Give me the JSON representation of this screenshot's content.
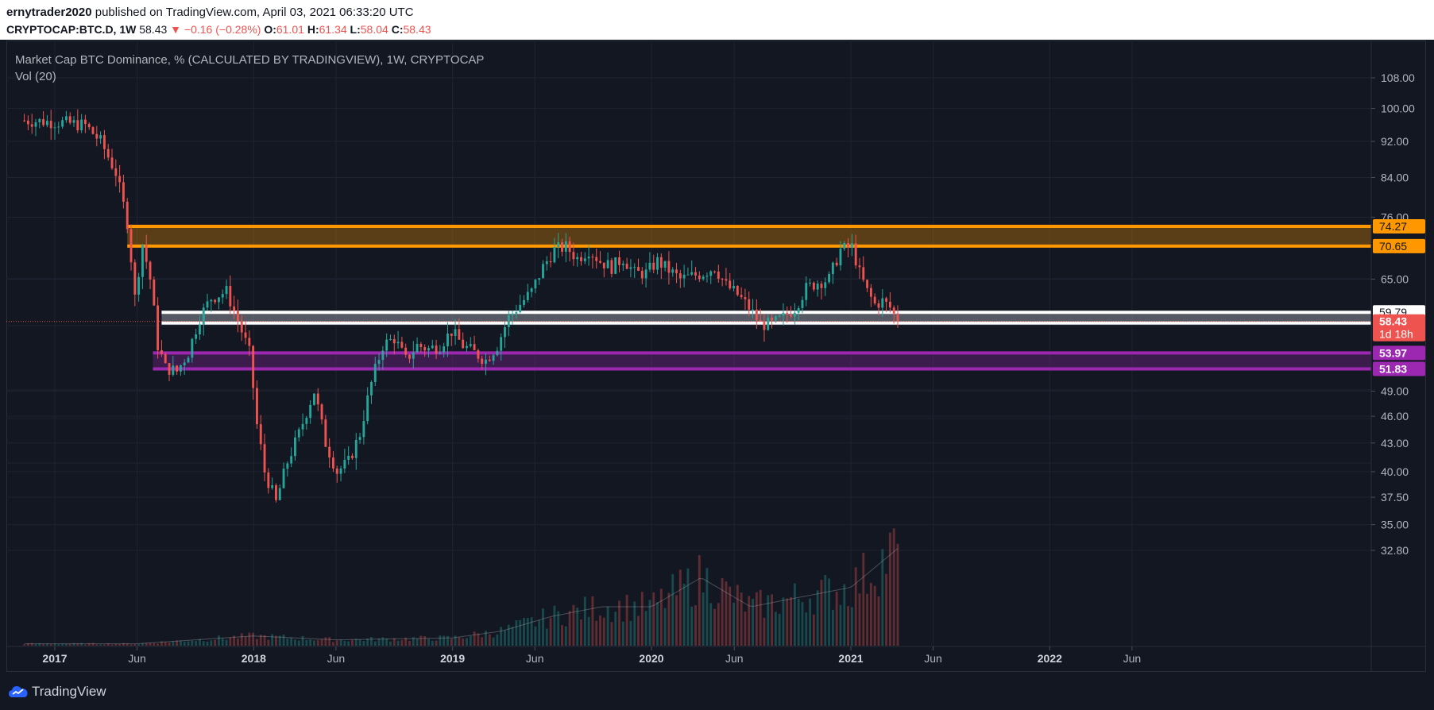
{
  "header": {
    "author": "ernytrader2020",
    "published_text": " published on TradingView.com, April 03, 2021 06:33:20 UTC",
    "symbol": "CRYPTOCAP:BTC.D, 1W",
    "last_price": "58.43",
    "change": "−0.16 (−0.28%)",
    "open_label": "O:",
    "open_value": "61.01",
    "high_label": "H:",
    "high_value": "61.34",
    "low_label": "L:",
    "low_value": "58.04",
    "close_label": "C:",
    "close_value": "58.43"
  },
  "legend": {
    "title": "Market Cap BTC Dominance, % (CALCULATED BY TRADINGVIEW), 1W, CRYPTOCAP",
    "volume": "Vol (20)"
  },
  "footer": {
    "brand": "TradingView"
  },
  "colors": {
    "background": "#131722",
    "up": "#26a69a",
    "down": "#ef5350",
    "orange_zone": "#ff9800",
    "purple_zone": "#9c27b0",
    "white_zone": "#ffffff"
  },
  "chart_data": {
    "type": "candlestick",
    "title": "Market Cap BTC Dominance, % (CALCULATED BY TRADINGVIEW), 1W, CRYPTOCAP",
    "x_tick_labels": [
      "2017",
      "Jun",
      "2018",
      "Jun",
      "2019",
      "Jun",
      "2020",
      "Jun",
      "2021",
      "Jun",
      "2022",
      "Jun"
    ],
    "x_tick_dates": [
      "2017-01-01",
      "2017-06-01",
      "2018-01-01",
      "2018-06-01",
      "2019-01-01",
      "2019-06-01",
      "2020-01-01",
      "2020-06-01",
      "2021-01-01",
      "2021-06-01",
      "2022-01-01",
      "2022-06-01"
    ],
    "y_tick_labels": [
      "108.00",
      "100.00",
      "92.00",
      "84.00",
      "76.00",
      "65.00",
      "49.00",
      "46.00",
      "43.00",
      "40.00",
      "37.50",
      "35.00",
      "32.80"
    ],
    "y_axis": "log",
    "ylim": [
      32.0,
      110.0
    ],
    "last_price": 58.43,
    "countdown": "1d 18h",
    "zones": [
      {
        "name": "orange",
        "top": 74.27,
        "bottom": 70.65,
        "top_label": "74.27",
        "bottom_label": "70.65"
      },
      {
        "name": "white",
        "top": 59.79,
        "bottom": 58.19,
        "top_label": "59.79",
        "bottom_label": "58.19"
      },
      {
        "name": "purple",
        "top": 53.97,
        "bottom": 51.83,
        "top_label": "53.97",
        "bottom_label": "51.83"
      }
    ],
    "price_path": {
      "dates": [
        "2016-11-06",
        "2017-01-15",
        "2017-02-26",
        "2017-03-26",
        "2017-04-23",
        "2017-05-14",
        "2017-05-28",
        "2017-06-11",
        "2017-06-25",
        "2017-07-09",
        "2017-07-23",
        "2017-08-13",
        "2017-09-03",
        "2017-09-24",
        "2017-10-15",
        "2017-11-12",
        "2017-11-26",
        "2017-12-10",
        "2017-12-24",
        "2018-01-07",
        "2018-01-21",
        "2018-02-11",
        "2018-03-04",
        "2018-03-25",
        "2018-04-22",
        "2018-05-13",
        "2018-06-03",
        "2018-06-24",
        "2018-07-15",
        "2018-08-05",
        "2018-08-26",
        "2018-09-16",
        "2018-10-07",
        "2018-10-28",
        "2018-11-18",
        "2018-12-09",
        "2018-12-30",
        "2019-01-20",
        "2019-02-10",
        "2019-03-03",
        "2019-03-24",
        "2019-04-14",
        "2019-05-05",
        "2019-05-26",
        "2019-06-16",
        "2019-07-07",
        "2019-07-28",
        "2019-08-18",
        "2019-09-08",
        "2019-09-29",
        "2019-10-20",
        "2019-11-10",
        "2019-12-01",
        "2019-12-22",
        "2020-01-12",
        "2020-02-02",
        "2020-02-23",
        "2020-03-15",
        "2020-04-05",
        "2020-04-26",
        "2020-05-17",
        "2020-06-07",
        "2020-06-28",
        "2020-07-19",
        "2020-08-09",
        "2020-08-30",
        "2020-09-20",
        "2020-10-11",
        "2020-11-01",
        "2020-11-22",
        "2020-12-13",
        "2021-01-03",
        "2021-01-17",
        "2021-01-31",
        "2021-02-14",
        "2021-02-28",
        "2021-03-14",
        "2021-03-28"
      ],
      "values": [
        97.0,
        96.5,
        95.8,
        92.0,
        85.0,
        75.0,
        62.0,
        71.0,
        65.0,
        55.0,
        52.0,
        51.5,
        54.0,
        59.0,
        62.0,
        63.0,
        60.0,
        57.0,
        54.0,
        45.0,
        40.0,
        37.0,
        41.0,
        44.0,
        49.0,
        43.0,
        40.0,
        41.0,
        44.0,
        50.0,
        55.0,
        56.0,
        53.0,
        55.0,
        54.5,
        55.0,
        57.0,
        55.0,
        54.0,
        53.0,
        55.0,
        59.0,
        61.0,
        63.0,
        67.0,
        70.0,
        70.5,
        68.5,
        70.0,
        68.0,
        67.0,
        68.5,
        66.0,
        66.0,
        68.0,
        66.5,
        65.0,
        65.5,
        66.0,
        67.0,
        64.0,
        62.5,
        60.5,
        58.0,
        58.0,
        59.0,
        60.5,
        63.5,
        64.5,
        65.0,
        70.0,
        70.5,
        66.0,
        63.0,
        61.0,
        61.5,
        60.5,
        58.43
      ]
    },
    "volume_ma_path": {
      "dates": [
        "2017-06-01",
        "2018-01-01",
        "2018-06-01",
        "2019-01-01",
        "2019-04-01",
        "2019-07-01",
        "2019-10-01",
        "2020-01-01",
        "2020-04-01",
        "2020-07-01",
        "2020-10-01",
        "2021-01-01",
        "2021-03-28"
      ],
      "relative_values": [
        0.02,
        0.1,
        0.06,
        0.08,
        0.15,
        0.3,
        0.4,
        0.4,
        0.7,
        0.4,
        0.5,
        0.6,
        1.0
      ]
    }
  }
}
